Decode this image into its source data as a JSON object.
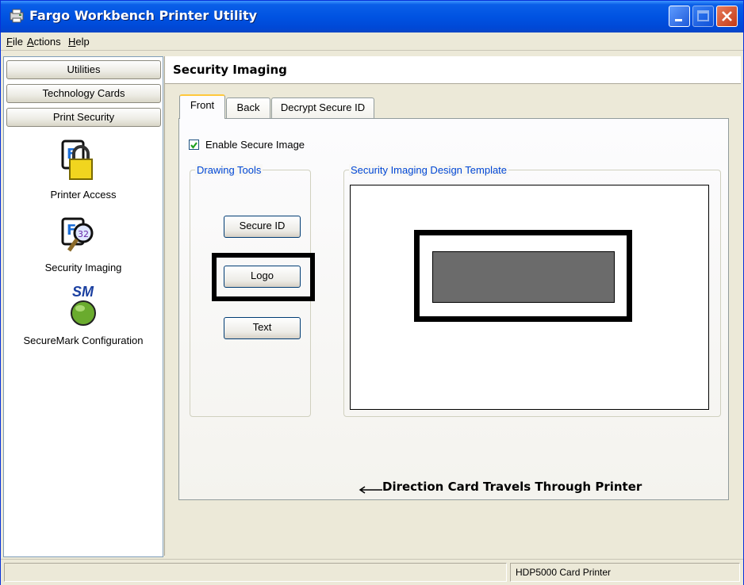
{
  "window": {
    "title": "Fargo Workbench Printer Utility"
  },
  "menu": [
    {
      "label": "File",
      "accel": "F",
      "rest": "ile"
    },
    {
      "label": "Actions",
      "accel": "A",
      "rest": "ctions"
    },
    {
      "label": "Help",
      "accel": "H",
      "rest": "elp"
    }
  ],
  "sidebar": {
    "categories": [
      "Utilities",
      "Technology Cards",
      "Print Security"
    ],
    "items": [
      {
        "label": "Printer Access",
        "icon": "lock-card-icon"
      },
      {
        "label": "Security Imaging",
        "icon": "magnifier-card-icon"
      },
      {
        "label": "SecureMark Configuration",
        "icon": "securemark-icon",
        "badge": "SM"
      }
    ]
  },
  "main": {
    "title": "Security Imaging",
    "tabs": [
      "Front",
      "Back",
      "Decrypt Secure ID"
    ],
    "active_tab": "Front",
    "enable_secure_image": {
      "label": "Enable Secure Image",
      "checked": true
    },
    "drawing_tools": {
      "legend": "Drawing Tools",
      "buttons": [
        "Secure ID",
        "Logo",
        "Text"
      ],
      "highlighted": "Logo"
    },
    "design_template": {
      "legend": "Security Imaging Design Template"
    },
    "direction_text": "Direction Card Travels Through Printer"
  },
  "status": {
    "left": "",
    "printer": "HDP5000 Card Printer"
  },
  "colors": {
    "titlebar": "#0053e2",
    "accent_legend": "#0046d5",
    "check": "#21a121",
    "securemark_green": "#6aab2e"
  }
}
